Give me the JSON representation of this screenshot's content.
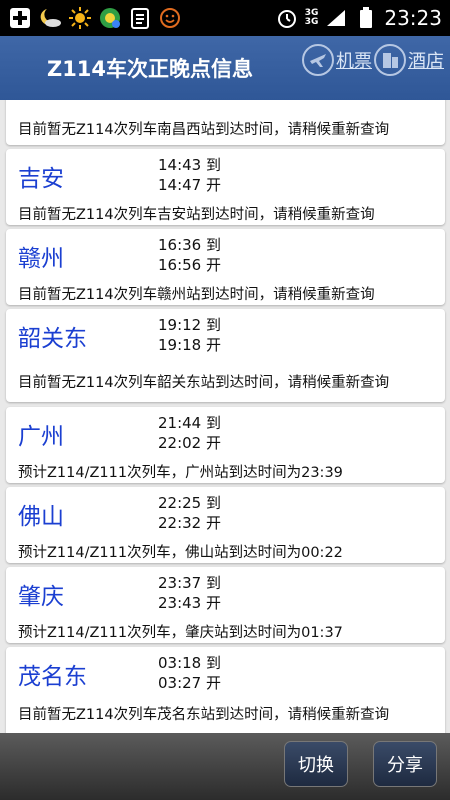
{
  "status_bar": {
    "time": "23:23",
    "network_top": "3G",
    "network_bottom": "3G"
  },
  "header": {
    "title": "Z114车次正晚点信息",
    "flight_label": "机票",
    "hotel_label": "酒店"
  },
  "stations": [
    {
      "name": "",
      "arrive": "",
      "depart": "",
      "note": "目前暂无Z114次列车南昌西站到达时间，请稍候重新查询"
    },
    {
      "name": "吉安",
      "arrive": "14:43 到",
      "depart": "14:47 开",
      "note": "目前暂无Z114次列车吉安站到达时间，请稍候重新查询"
    },
    {
      "name": "赣州",
      "arrive": "16:36 到",
      "depart": "16:56 开",
      "note": "目前暂无Z114次列车赣州站到达时间，请稍候重新查询"
    },
    {
      "name": "韶关东",
      "arrive": "19:12 到",
      "depart": "19:18 开",
      "note": "目前暂无Z114次列车韶关东站到达时间，请稍候重新查询"
    },
    {
      "name": "广州",
      "arrive": "21:44 到",
      "depart": "22:02 开",
      "note": "预计Z114/Z111次列车，广州站到达时间为23:39"
    },
    {
      "name": "佛山",
      "arrive": "22:25 到",
      "depart": "22:32 开",
      "note": "预计Z114/Z111次列车，佛山站到达时间为00:22"
    },
    {
      "name": "肇庆",
      "arrive": "23:37 到",
      "depart": "23:43 开",
      "note": "预计Z114/Z111次列车，肇庆站到达时间为01:37"
    },
    {
      "name": "茂名东",
      "arrive": "03:18 到",
      "depart": "03:27 开",
      "note": "目前暂无Z114次列车茂名东站到达时间，请稍候重新查询"
    }
  ],
  "bottom_bar": {
    "switch_label": "切换",
    "share_label": "分享"
  },
  "icons": {
    "add": "plus-square-icon",
    "weather_night": "moon-cloud-icon",
    "weather_sun": "sun-icon",
    "app": "green-app-icon",
    "clipboard": "clipboard-icon",
    "emoji": "smiley-icon",
    "alarm": "alarm-clock-icon",
    "signal": "signal-icon",
    "battery": "battery-icon",
    "airplane": "airplane-icon",
    "hotel": "building-icon"
  },
  "colors": {
    "title_bar": "#3a61a2",
    "station_name": "#1b3fd1"
  }
}
